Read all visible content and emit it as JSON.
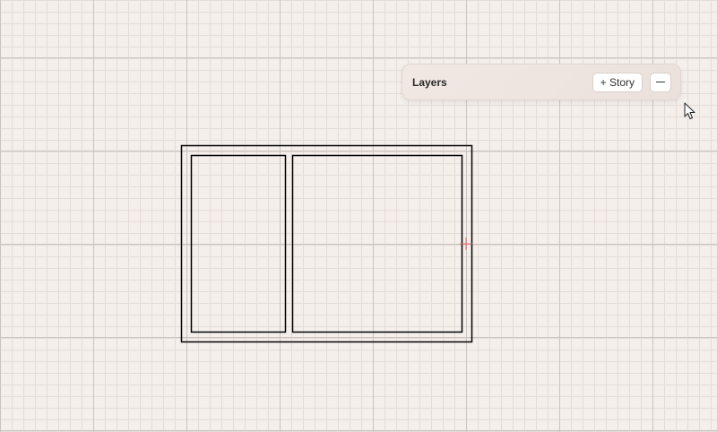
{
  "layers_panel": {
    "title": "Layers",
    "add_story_label": "+ Story",
    "collapse_icon": "minus-icon"
  },
  "canvas": {
    "background_color": "#f5efec",
    "wall_color": "#000000",
    "origin_marker_color": "#e06a6a",
    "cursor_icon": "arrow-pointer-icon"
  }
}
